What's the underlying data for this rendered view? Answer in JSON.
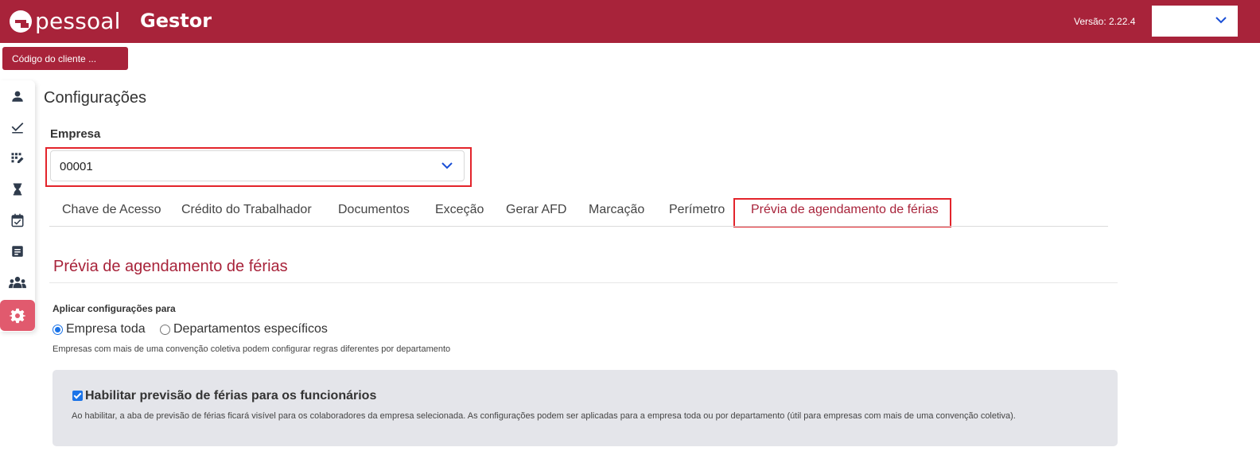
{
  "header": {
    "brand": "pessoal",
    "app_name": "Gestor",
    "version": "Versão: 2.22.4"
  },
  "client_code": "Código do cliente  ...",
  "sidebar": {
    "items": [
      {
        "icon": "person-icon"
      },
      {
        "icon": "check-icon"
      },
      {
        "icon": "grid-edit-icon"
      },
      {
        "icon": "hourglass-icon"
      },
      {
        "icon": "calendar-check-icon"
      },
      {
        "icon": "document-icon"
      },
      {
        "icon": "group-icon"
      },
      {
        "icon": "gear-icon",
        "active": true
      }
    ]
  },
  "page_title": "Configurações",
  "empresa": {
    "label": "Empresa",
    "value": "00001"
  },
  "tabs": [
    {
      "label": "Chave de Acesso"
    },
    {
      "label": "Crédito do Trabalhador"
    },
    {
      "label": "Documentos"
    },
    {
      "label": "Exceção"
    },
    {
      "label": "Gerar AFD"
    },
    {
      "label": "Marcação"
    },
    {
      "label": "Perímetro"
    },
    {
      "label": "Prévia de agendamento de férias",
      "active": true
    }
  ],
  "section": {
    "title": "Prévia de agendamento de férias",
    "apply_label": "Aplicar configurações para",
    "options": [
      "Empresa toda",
      "Departamentos específicos"
    ],
    "selected": "Empresa toda",
    "hint": "Empresas com mais de uma convenção coletiva podem configurar regras diferentes por departamento"
  },
  "panel": {
    "checked": true,
    "title": "Habilitar previsão de férias para os funcionários",
    "description": "Ao habilitar, a aba de previsão de férias ficará visível para os colaboradores da empresa selecionada. As configurações podem ser aplicadas para a empresa toda ou por departamento (útil para empresas com mais de uma convenção coletiva)."
  },
  "colors": {
    "brand": "#a8233a",
    "highlight_box": "#e3242b",
    "sidebar_active": "#e15a6e",
    "accent_blue": "#1a73e8"
  }
}
